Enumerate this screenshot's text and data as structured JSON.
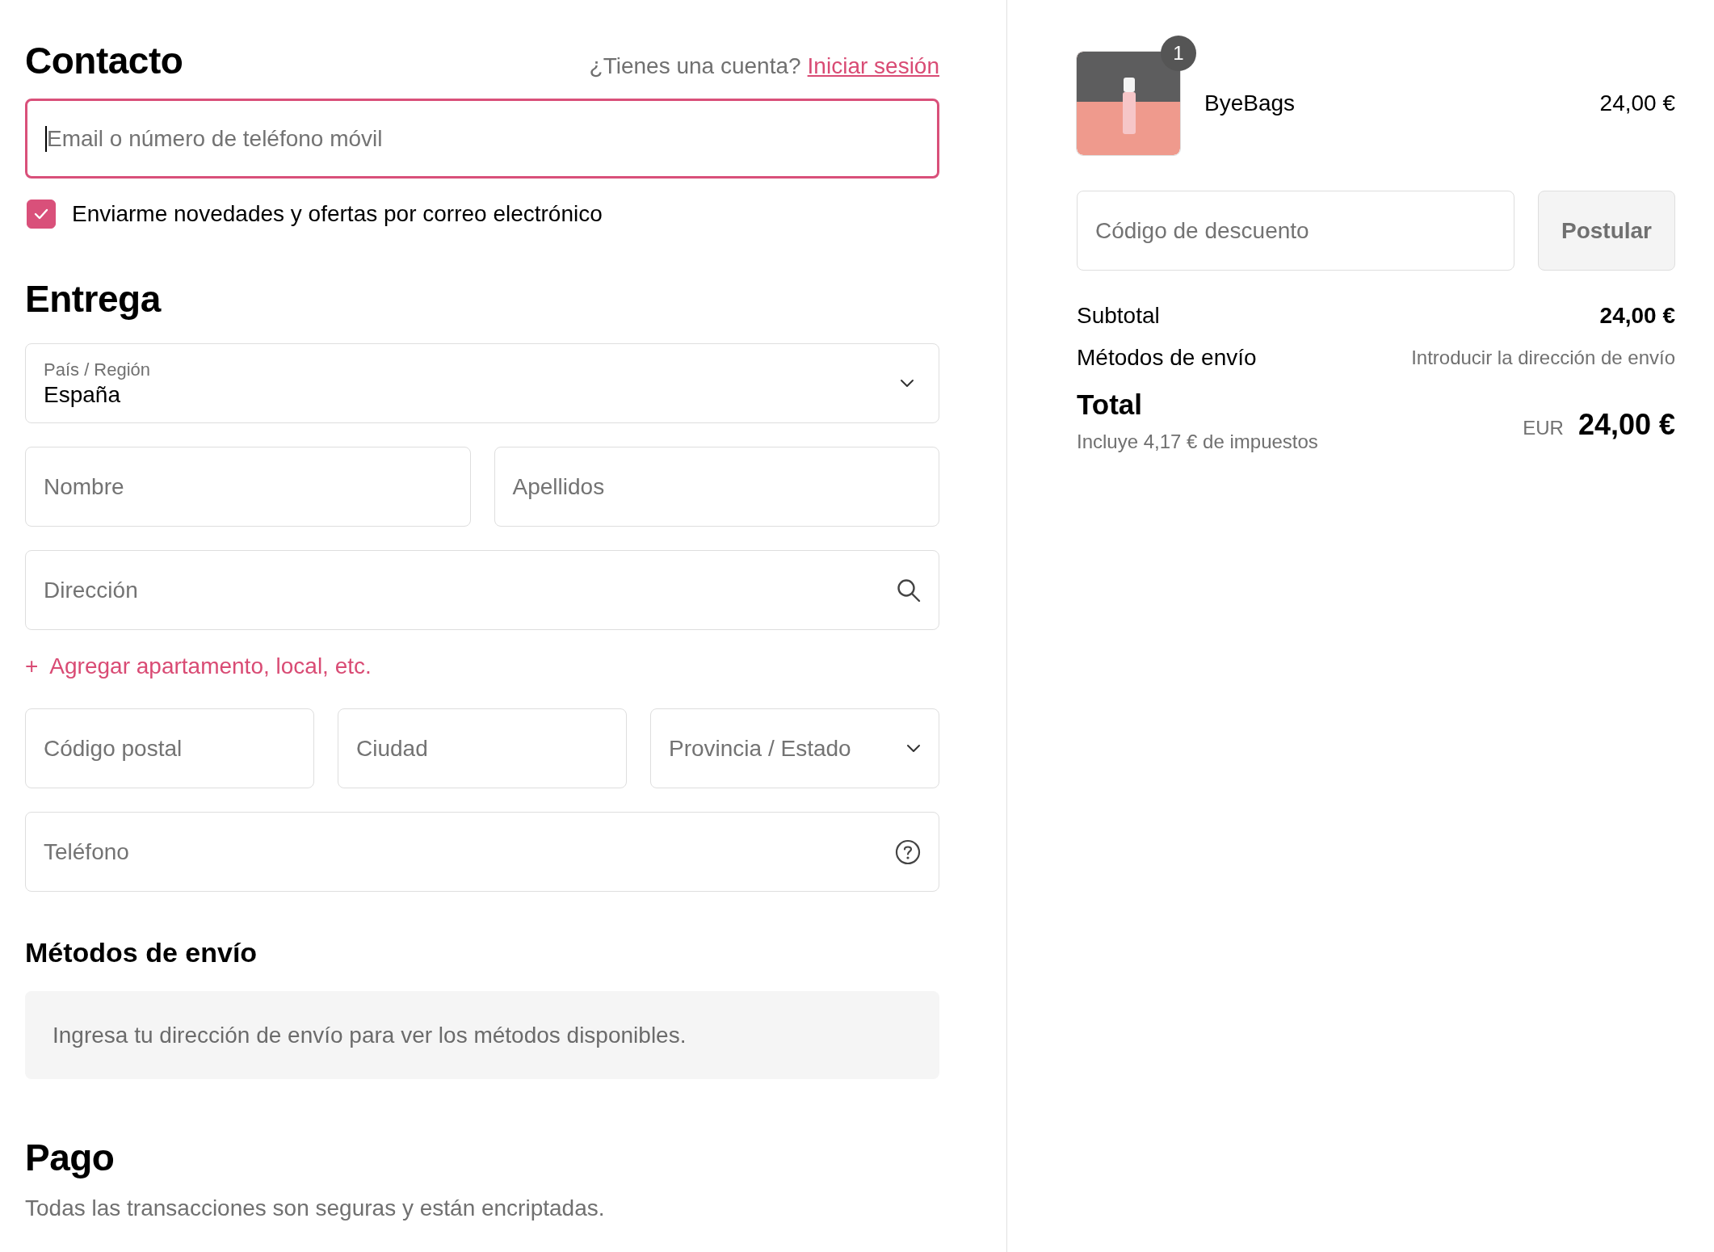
{
  "contact": {
    "heading": "Contacto",
    "account_prompt": "¿Tienes una cuenta?",
    "login_link": "Iniciar sesión",
    "email": {
      "placeholder": "Email o número de teléfono móvil",
      "focused": true
    },
    "newsletter": {
      "label": "Enviarme novedades y ofertas por correo electrónico",
      "checked": true
    }
  },
  "delivery": {
    "heading": "Entrega",
    "rows": [
      [
        {
          "kind": "select",
          "label": "País / Región",
          "value": "España"
        }
      ],
      [
        {
          "kind": "text",
          "placeholder": "Nombre"
        },
        {
          "kind": "text",
          "placeholder": "Apellidos"
        }
      ],
      [
        {
          "kind": "search",
          "placeholder": "Dirección"
        }
      ],
      [
        {
          "kind": "link",
          "plus": "+",
          "label": "Agregar apartamento, local, etc."
        }
      ],
      [
        {
          "kind": "text",
          "placeholder": "Código postal"
        },
        {
          "kind": "text",
          "placeholder": "Ciudad"
        },
        {
          "kind": "dropdown",
          "placeholder": "Provincia / Estado"
        }
      ],
      [
        {
          "kind": "help",
          "placeholder": "Teléfono"
        }
      ]
    ]
  },
  "shipping": {
    "heading": "Métodos de envío",
    "notice": "Ingresa tu dirección de envío para ver los métodos disponibles."
  },
  "payment": {
    "heading": "Pago",
    "note": "Todas las transacciones son seguras y están encriptadas."
  },
  "summary": {
    "item": {
      "quantity": "1",
      "name": "ByeBags",
      "price": "24,00 €"
    },
    "discount": {
      "placeholder": "Código de descuento",
      "button": "Postular"
    },
    "lines": [
      {
        "label": "Subtotal",
        "value": "24,00 €"
      },
      {
        "label": "Métodos de envío",
        "value": "Introducir la dirección de envío"
      }
    ],
    "total": {
      "label": "Total",
      "tax_note": "Incluye 4,17 € de impuestos",
      "currency": "EUR",
      "amount": "24,00 €"
    }
  }
}
